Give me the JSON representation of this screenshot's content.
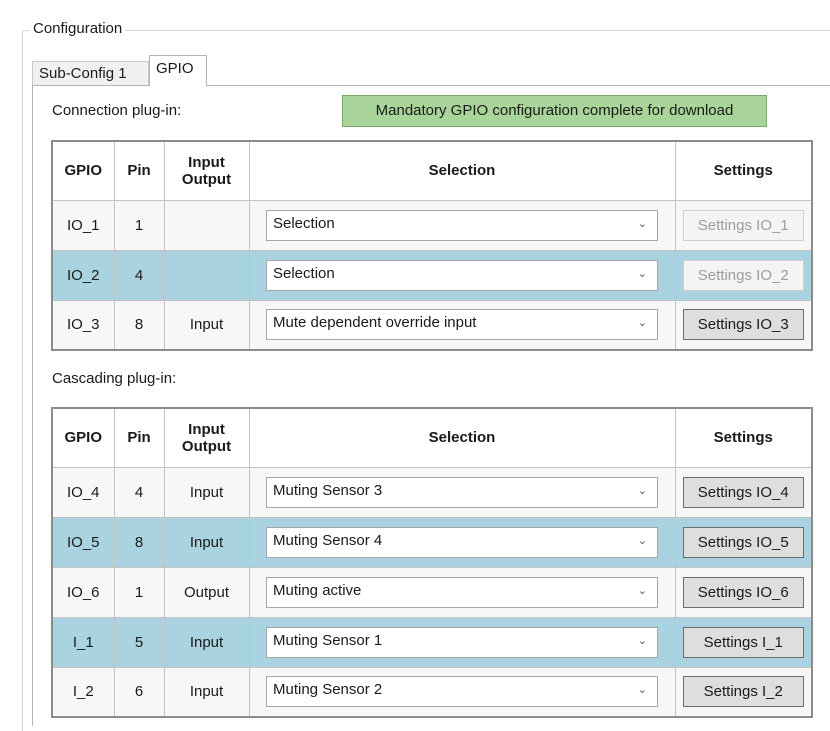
{
  "group": {
    "title": "Configuration"
  },
  "tabs": [
    {
      "label": "Sub-Config 1",
      "active": false
    },
    {
      "label": "GPIO",
      "active": true
    }
  ],
  "connection": {
    "label": "Connection plug-in:",
    "banner": "Mandatory GPIO configuration complete for download",
    "banner_color": "#a9d49a",
    "headers": {
      "gpio": "GPIO",
      "pin": "Pin",
      "io_line1": "Input",
      "io_line2": "Output",
      "selection": "Selection",
      "settings": "Settings"
    },
    "rows": [
      {
        "gpio": "IO_1",
        "pin": "1",
        "io": "",
        "selection": "Selection",
        "settings": "Settings IO_1",
        "settings_enabled": false
      },
      {
        "gpio": "IO_2",
        "pin": "4",
        "io": "",
        "selection": "Selection",
        "settings": "Settings IO_2",
        "settings_enabled": false
      },
      {
        "gpio": "IO_3",
        "pin": "8",
        "io": "Input",
        "selection": "Mute dependent override input",
        "settings": "Settings IO_3",
        "settings_enabled": true
      }
    ]
  },
  "cascading": {
    "label": "Cascading plug-in:",
    "headers": {
      "gpio": "GPIO",
      "pin": "Pin",
      "io_line1": "Input",
      "io_line2": "Output",
      "selection": "Selection",
      "settings": "Settings"
    },
    "rows": [
      {
        "gpio": "IO_4",
        "pin": "4",
        "io": "Input",
        "selection": "Muting Sensor 3",
        "settings": "Settings IO_4",
        "settings_enabled": true
      },
      {
        "gpio": "IO_5",
        "pin": "8",
        "io": "Input",
        "selection": "Muting Sensor 4",
        "settings": "Settings IO_5",
        "settings_enabled": true
      },
      {
        "gpio": "IO_6",
        "pin": "1",
        "io": "Output",
        "selection": "Muting active",
        "settings": "Settings IO_6",
        "settings_enabled": true
      },
      {
        "gpio": "I_1",
        "pin": "5",
        "io": "Input",
        "selection": "Muting Sensor 1",
        "settings": "Settings I_1",
        "settings_enabled": true
      },
      {
        "gpio": "I_2",
        "pin": "6",
        "io": "Input",
        "selection": "Muting Sensor 2",
        "settings": "Settings I_2",
        "settings_enabled": true
      }
    ]
  },
  "colors": {
    "row_alt": "#a9d3e0",
    "row_plain": "#f7f7f7"
  },
  "icons": {
    "dropdown": "chevron-down-icon"
  }
}
